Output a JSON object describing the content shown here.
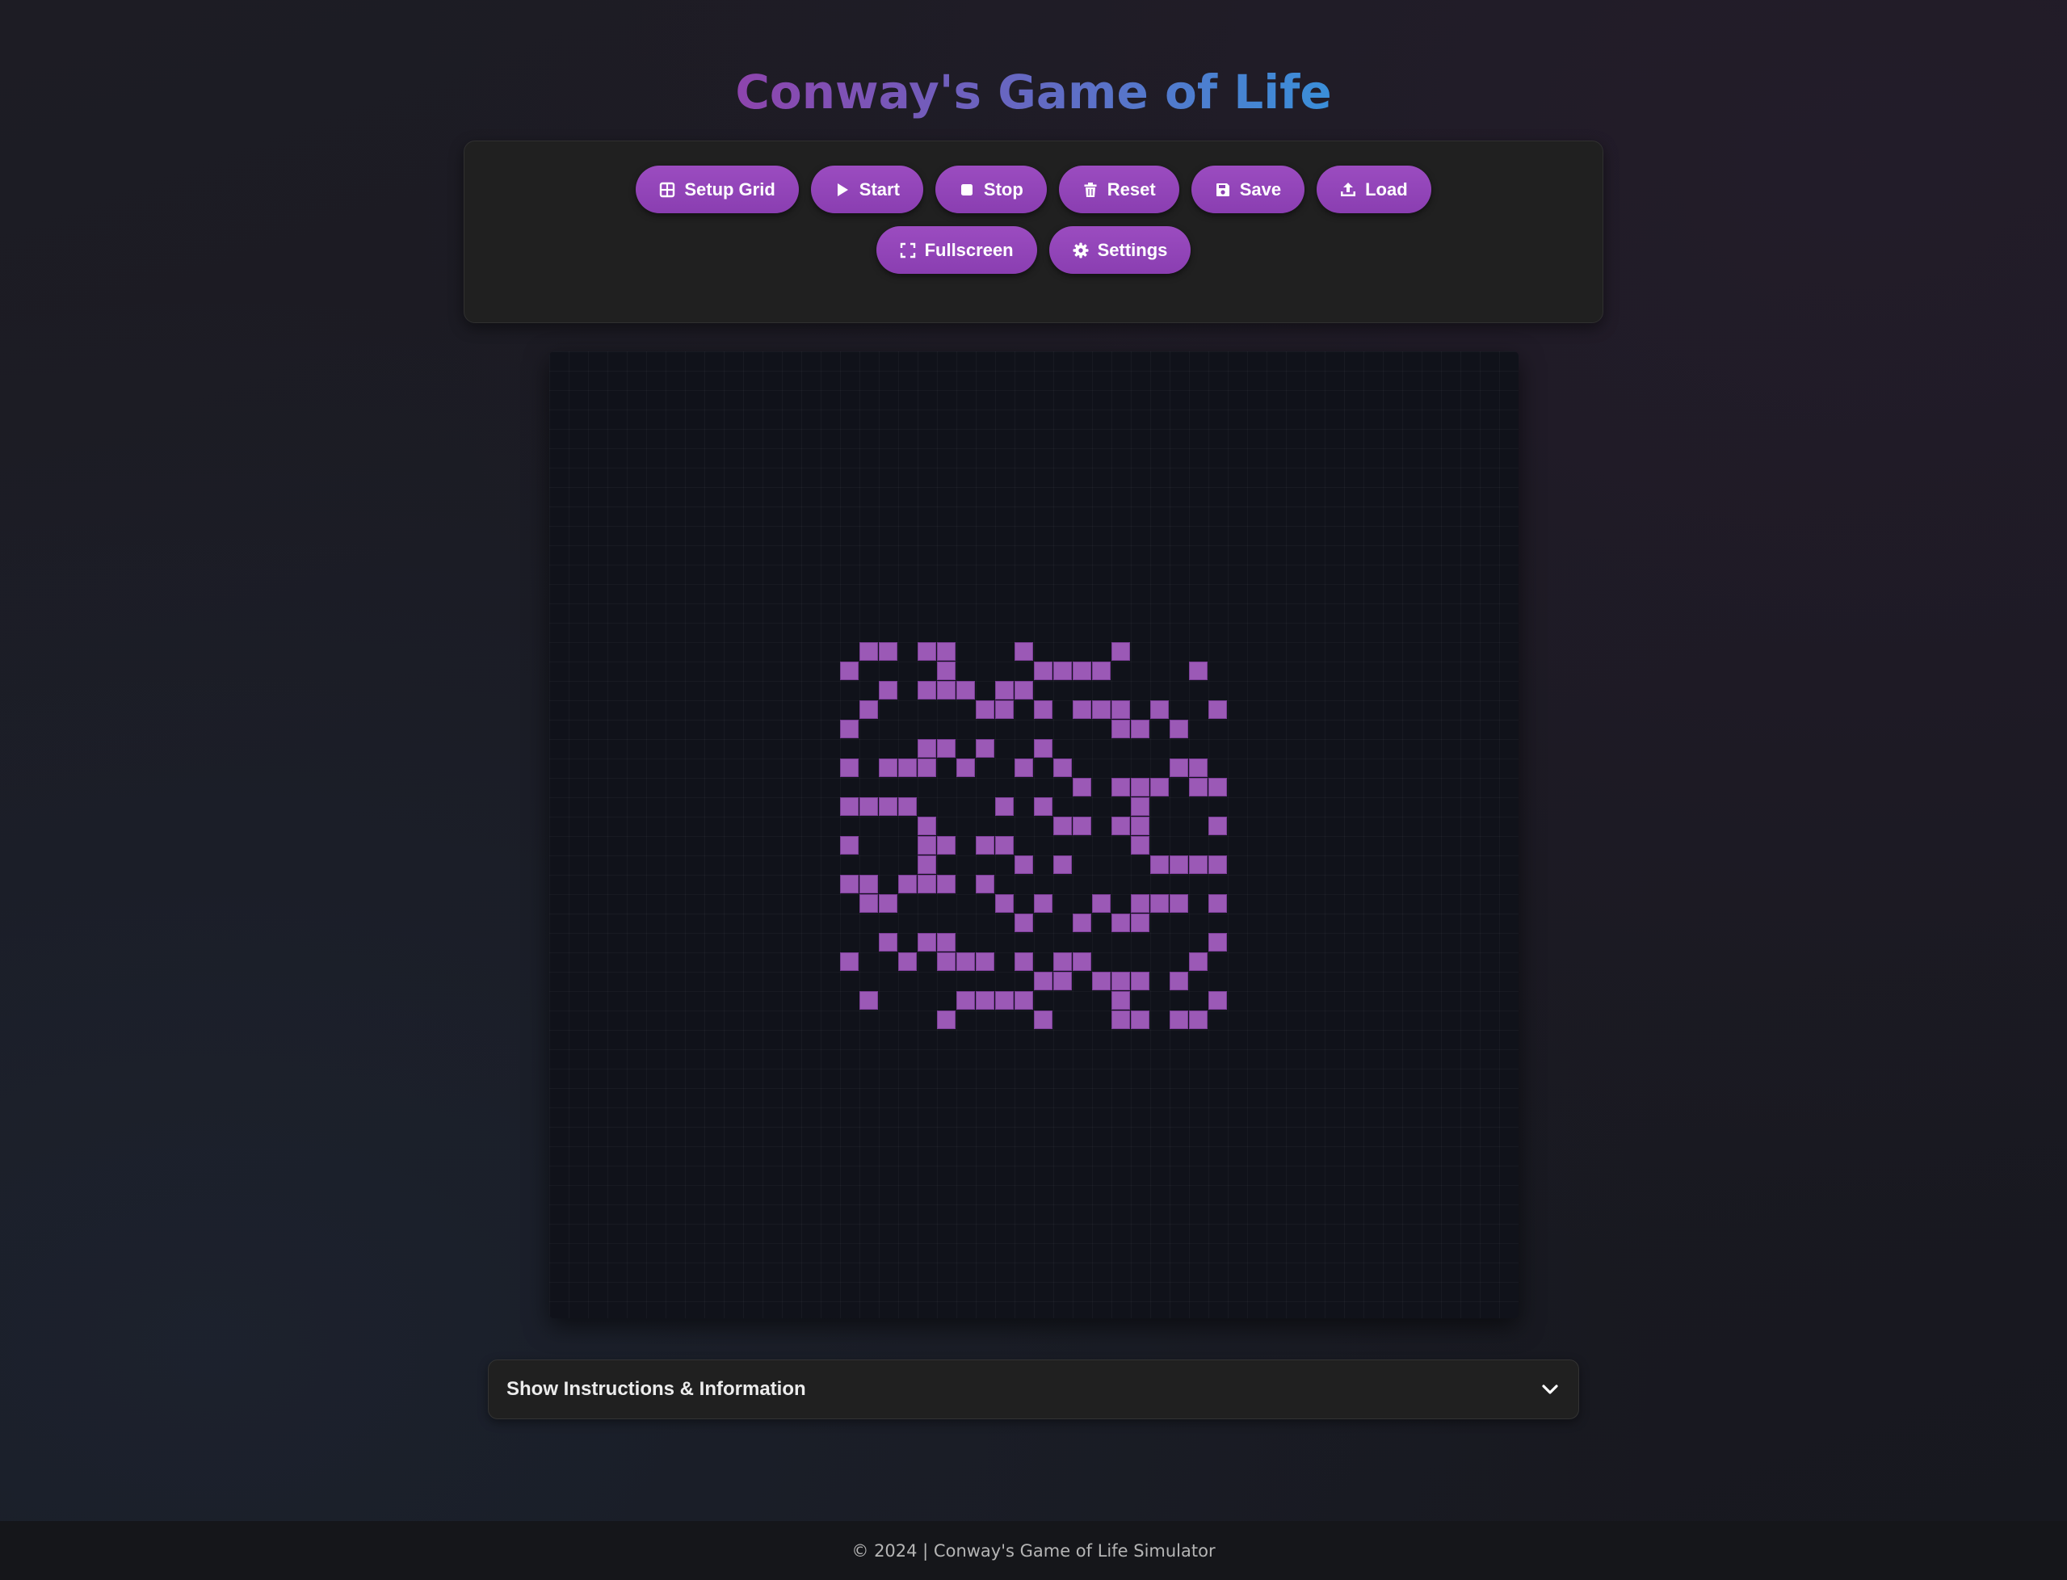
{
  "page_title": "Conway's Game of Life",
  "toolbar": {
    "setup_grid_label": "Setup Grid",
    "start_label": "Start",
    "stop_label": "Stop",
    "reset_label": "Reset",
    "save_label": "Save",
    "load_label": "Load",
    "fullscreen_label": "Fullscreen",
    "settings_label": "Settings"
  },
  "icons": {
    "setup_grid": "grid-icon",
    "start": "play-icon",
    "stop": "stop-icon",
    "reset": "trash-icon",
    "save": "floppy-disk-icon",
    "load": "upload-icon",
    "fullscreen": "expand-icon",
    "settings": "gear-icon",
    "instructions": "chevron-down-icon"
  },
  "colors": {
    "accent": "#9b59b6",
    "button": "#8e44ad",
    "title_start": "#8e44ad",
    "title_end": "#3a8fd9",
    "board_bg": "#10121a"
  },
  "board": {
    "alive_cells": [
      [
        0,
        1
      ],
      [
        0,
        2
      ],
      [
        0,
        4
      ],
      [
        0,
        5
      ],
      [
        0,
        9
      ],
      [
        0,
        14
      ],
      [
        1,
        0
      ],
      [
        1,
        5
      ],
      [
        1,
        10
      ],
      [
        1,
        11
      ],
      [
        1,
        12
      ],
      [
        1,
        13
      ],
      [
        1,
        18
      ],
      [
        2,
        2
      ],
      [
        2,
        4
      ],
      [
        2,
        5
      ],
      [
        2,
        6
      ],
      [
        2,
        8
      ],
      [
        2,
        9
      ],
      [
        3,
        1
      ],
      [
        3,
        7
      ],
      [
        3,
        8
      ],
      [
        3,
        10
      ],
      [
        3,
        12
      ],
      [
        3,
        13
      ],
      [
        3,
        14
      ],
      [
        3,
        16
      ],
      [
        3,
        19
      ],
      [
        4,
        0
      ],
      [
        4,
        14
      ],
      [
        4,
        15
      ],
      [
        4,
        17
      ],
      [
        5,
        4
      ],
      [
        5,
        5
      ],
      [
        5,
        7
      ],
      [
        5,
        10
      ],
      [
        6,
        0
      ],
      [
        6,
        2
      ],
      [
        6,
        3
      ],
      [
        6,
        4
      ],
      [
        6,
        6
      ],
      [
        6,
        9
      ],
      [
        6,
        11
      ],
      [
        6,
        17
      ],
      [
        6,
        18
      ],
      [
        7,
        12
      ],
      [
        7,
        14
      ],
      [
        7,
        15
      ],
      [
        7,
        16
      ],
      [
        7,
        18
      ],
      [
        7,
        19
      ],
      [
        8,
        0
      ],
      [
        8,
        1
      ],
      [
        8,
        2
      ],
      [
        8,
        3
      ],
      [
        8,
        8
      ],
      [
        8,
        10
      ],
      [
        8,
        15
      ],
      [
        9,
        4
      ],
      [
        9,
        11
      ],
      [
        9,
        12
      ],
      [
        9,
        14
      ],
      [
        9,
        15
      ],
      [
        9,
        19
      ],
      [
        10,
        0
      ],
      [
        10,
        4
      ],
      [
        10,
        5
      ],
      [
        10,
        7
      ],
      [
        10,
        8
      ],
      [
        10,
        15
      ],
      [
        11,
        4
      ],
      [
        11,
        9
      ],
      [
        11,
        11
      ],
      [
        11,
        16
      ],
      [
        11,
        17
      ],
      [
        11,
        18
      ],
      [
        11,
        19
      ],
      [
        12,
        0
      ],
      [
        12,
        1
      ],
      [
        12,
        3
      ],
      [
        12,
        4
      ],
      [
        12,
        5
      ],
      [
        12,
        7
      ],
      [
        13,
        1
      ],
      [
        13,
        2
      ],
      [
        13,
        8
      ],
      [
        13,
        10
      ],
      [
        13,
        13
      ],
      [
        13,
        15
      ],
      [
        13,
        16
      ],
      [
        13,
        17
      ],
      [
        13,
        19
      ],
      [
        14,
        9
      ],
      [
        14,
        12
      ],
      [
        14,
        14
      ],
      [
        14,
        15
      ],
      [
        15,
        2
      ],
      [
        15,
        4
      ],
      [
        15,
        5
      ],
      [
        15,
        19
      ],
      [
        16,
        0
      ],
      [
        16,
        3
      ],
      [
        16,
        5
      ],
      [
        16,
        6
      ],
      [
        16,
        7
      ],
      [
        16,
        9
      ],
      [
        16,
        11
      ],
      [
        16,
        12
      ],
      [
        16,
        18
      ],
      [
        17,
        10
      ],
      [
        17,
        11
      ],
      [
        17,
        13
      ],
      [
        17,
        14
      ],
      [
        17,
        15
      ],
      [
        17,
        17
      ],
      [
        18,
        1
      ],
      [
        18,
        6
      ],
      [
        18,
        7
      ],
      [
        18,
        8
      ],
      [
        18,
        9
      ],
      [
        18,
        14
      ],
      [
        18,
        19
      ],
      [
        19,
        5
      ],
      [
        19,
        10
      ],
      [
        19,
        14
      ],
      [
        19,
        15
      ],
      [
        19,
        17
      ],
      [
        19,
        18
      ]
    ]
  },
  "instructions_toggle_label": "Show Instructions & Information",
  "footer_text": "© 2024 | Conway's Game of Life Simulator"
}
